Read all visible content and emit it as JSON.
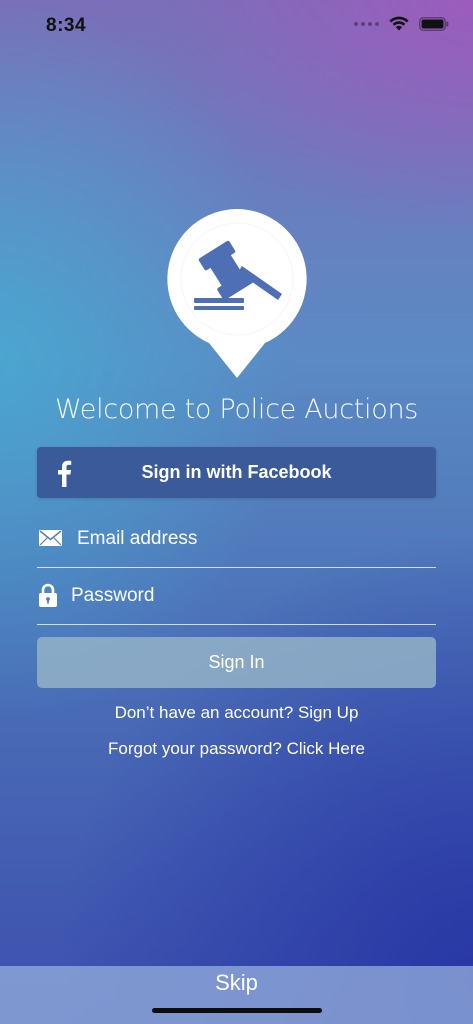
{
  "status_bar": {
    "time": "8:34"
  },
  "welcome": {
    "title": "Welcome to Police Auctions"
  },
  "facebook": {
    "label": "Sign in with Facebook",
    "color": "#3b5a9a"
  },
  "form": {
    "email_placeholder": "Email address",
    "password_placeholder": "Password",
    "sign_in_label": "Sign In"
  },
  "links": {
    "no_account_text": "Don’t have an account? ",
    "sign_up_label": "Sign Up",
    "forgot_text": "Forgot your password? ",
    "click_here_label": "Click Here"
  },
  "bottom": {
    "skip_label": "Skip"
  },
  "icons": {
    "logo": "gavel-pin-icon",
    "facebook": "facebook-icon",
    "email": "envelope-icon",
    "password": "lock-icon"
  }
}
